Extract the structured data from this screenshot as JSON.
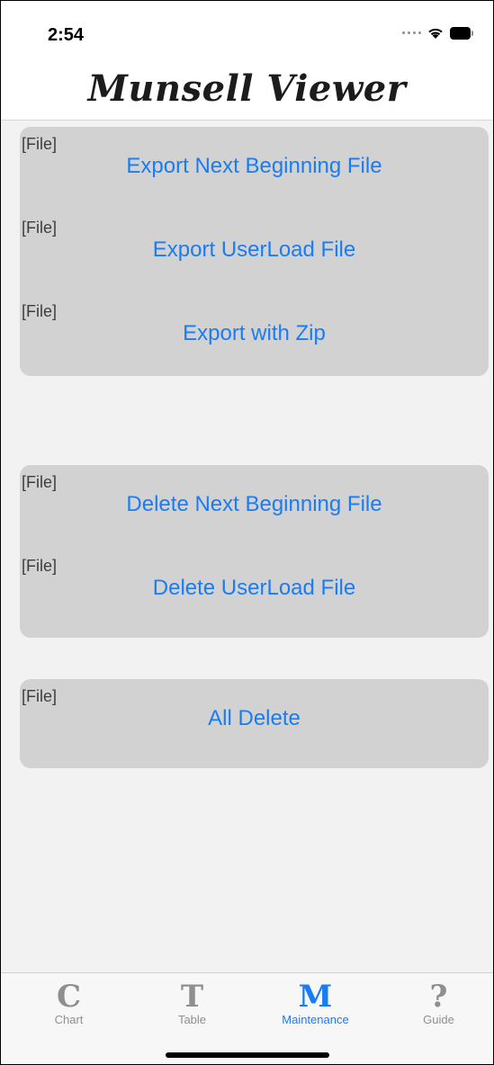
{
  "status_bar": {
    "time": "2:54",
    "icons": [
      "signal-dots-icon",
      "wifi-icon",
      "battery-icon"
    ]
  },
  "header": {
    "title": "Munsell Viewer"
  },
  "groups": [
    {
      "rows": [
        {
          "tag": "[File]",
          "label": "Export Next Beginning File"
        },
        {
          "tag": "[File]",
          "label": "Export UserLoad File"
        },
        {
          "tag": "[File]",
          "label": "Export with Zip"
        }
      ]
    },
    {
      "rows": [
        {
          "tag": "[File]",
          "label": "Delete Next Beginning File"
        },
        {
          "tag": "[File]",
          "label": "Delete UserLoad File"
        }
      ]
    },
    {
      "rows": [
        {
          "tag": "[File]",
          "label": "All Delete"
        }
      ]
    }
  ],
  "tab_bar": {
    "tabs": [
      {
        "icon": "C",
        "label": "Chart",
        "active": false
      },
      {
        "icon": "T",
        "label": "Table",
        "active": false
      },
      {
        "icon": "M",
        "label": "Maintenance",
        "active": true
      },
      {
        "icon": "?",
        "label": "Guide",
        "active": false
      }
    ]
  },
  "colors": {
    "accent": "#1a7cf5",
    "group_bg": "#d2d2d2",
    "content_bg": "#f2f2f2",
    "inactive_tab": "#8f8f8f"
  }
}
